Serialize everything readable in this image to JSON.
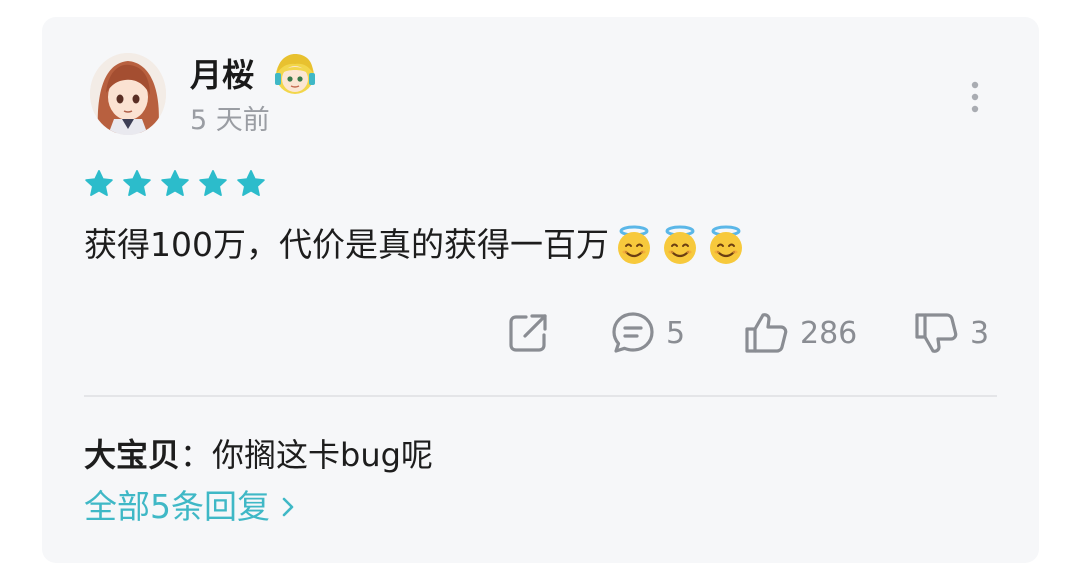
{
  "review": {
    "username": "月桜",
    "timestamp": "5 天前",
    "rating": 5,
    "content": "获得100万，代价是真的获得一百万",
    "emojis": [
      "smiling-face-with-halo",
      "smiling-face-with-halo",
      "smiling-face-with-halo"
    ]
  },
  "actions": {
    "share_icon": "share-icon",
    "comment_count": "5",
    "like_count": "286",
    "dislike_count": "3"
  },
  "reply_preview": {
    "author": "大宝贝",
    "separator": "：",
    "text": "你搁这卡bug呢",
    "view_all_label": "全部5条回复"
  },
  "colors": {
    "accent": "#2cbccb",
    "link": "#3fb8c6",
    "muted": "#8a8d93",
    "card_bg": "#f6f7f9"
  }
}
